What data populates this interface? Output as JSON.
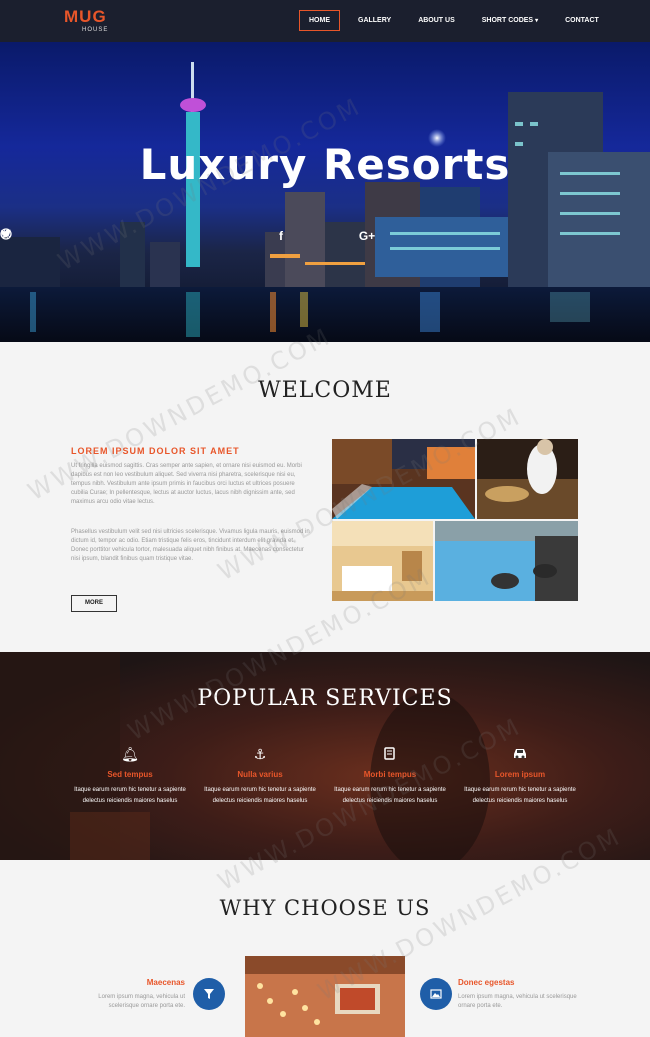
{
  "brand": {
    "name": "MUG",
    "sub": "HOUSE"
  },
  "nav": {
    "items": [
      {
        "label": "HOME",
        "active": true
      },
      {
        "label": "GALLERY"
      },
      {
        "label": "ABOUT US"
      },
      {
        "label": "SHORT CODES",
        "dropdown": true
      },
      {
        "label": "CONTACT"
      }
    ]
  },
  "hero": {
    "title": "Luxury Resorts",
    "socials": [
      "facebook-icon",
      "twitter-icon",
      "dribbble-icon",
      "google-plus-icon"
    ]
  },
  "welcome": {
    "title": "WELCOME",
    "heading": "LOREM IPSUM DOLOR SIT AMET",
    "paragraph1": "Ut fringilla euismod sagittis. Cras semper ante sapien, et ornare nisi euismod eu. Morbi dapibus est non leo vestibulum aliquet. Sed viverra nisi pharetra, scelerisque nisi eu, tempus nibh. Vestibulum ante ipsum primis in faucibus orci luctus et ultrices posuere cubilia Curae; In pellentesque, lectus at auctor luctus, lacus nibh dignissim ante, sed maximus arcu odio vitae lectus.",
    "paragraph2": "Phasellus vestibulum velit sed nisi ultricies scelerisque. Vivamus ligula mauris, euismod in dictum id, tempor ac odio. Etiam tristique felis eros, tincidunt interdum elit gravida et. Donec porttitor vehicula tortor, malesuada aliquet nibh finibus at. Maecenas consectetur nisi ipsum, blandit finibus quam tristique vitae.",
    "more": "MORE"
  },
  "services": {
    "title": "POPULAR SERVICES",
    "items": [
      {
        "icon": "bell-icon",
        "title": "Sed tempus",
        "text": "Itaque earum rerum hic tenetur a sapiente delectus reiciendis maiores haselus"
      },
      {
        "icon": "anchor-icon",
        "title": "Nulla varius",
        "text": "Itaque earum rerum hic tenetur a sapiente delectus reiciendis maiores haselus"
      },
      {
        "icon": "book-icon",
        "title": "Morbi tempus",
        "text": "Itaque earum rerum hic tenetur a sapiente delectus reiciendis maiores haselus"
      },
      {
        "icon": "car-icon",
        "title": "Lorem ipsum",
        "text": "Itaque earum rerum hic tenetur a sapiente delectus reiciendis maiores haselus"
      }
    ]
  },
  "why": {
    "title": "WHY CHOOSE US",
    "left": {
      "title": "Maecenas",
      "text": "Lorem ipsum magna, vehicula ut scelerisque ornare porta ete."
    },
    "right": {
      "title": "Donec egestas",
      "text": "Lorem ipsum magna, vehicula ut scelerisque ornare porta ete."
    }
  },
  "watermark": "WWW.DOWNDEMO.COM",
  "colors": {
    "accent": "#e8562a",
    "nav_bg": "#1b1f2e",
    "circle": "#1f5ea8"
  }
}
